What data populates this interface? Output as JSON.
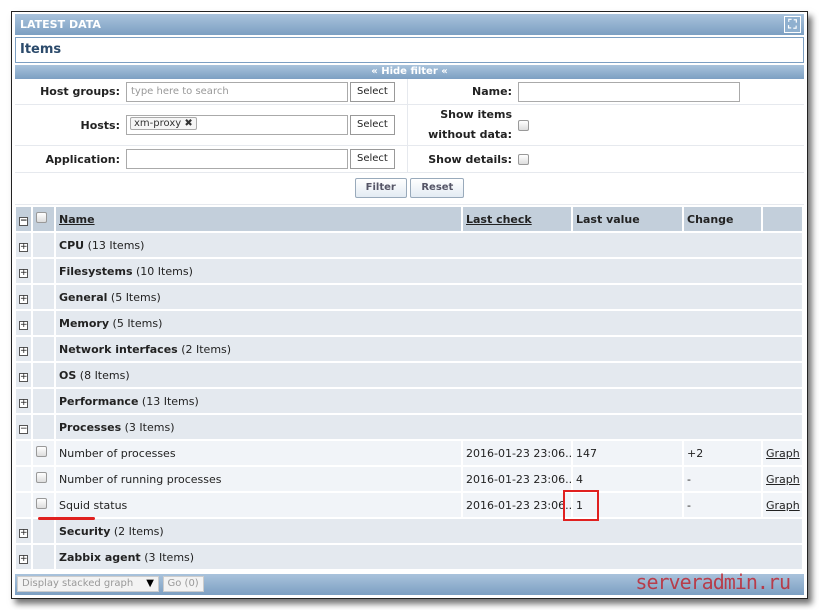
{
  "header": {
    "title": "LATEST DATA",
    "fullscreen_icon": "fullscreen-icon"
  },
  "section_title": "Items",
  "filter_toggle": "Hide filter",
  "filter": {
    "host_groups_label": "Host groups:",
    "host_groups_placeholder": "type here to search",
    "hosts_label": "Hosts:",
    "hosts_chip": "xm-proxy",
    "application_label": "Application:",
    "select_label": "Select",
    "name_label": "Name:",
    "show_items_label_1": "Show items",
    "show_items_label_2": "without data:",
    "show_details_label": "Show details:",
    "filter_button": "Filter",
    "reset_button": "Reset"
  },
  "table": {
    "columns": {
      "name": "Name",
      "last_check": "Last check",
      "last_value": "Last value",
      "change": "Change"
    },
    "groups": [
      {
        "name": "CPU",
        "count": "(13 Items)"
      },
      {
        "name": "Filesystems",
        "count": "(10 Items)"
      },
      {
        "name": "General",
        "count": "(5 Items)"
      },
      {
        "name": "Memory",
        "count": "(5 Items)"
      },
      {
        "name": "Network interfaces",
        "count": "(2 Items)"
      },
      {
        "name": "OS",
        "count": "(8 Items)"
      },
      {
        "name": "Performance",
        "count": "(13 Items)"
      },
      {
        "name": "Processes",
        "count": "(3 Items)"
      },
      {
        "name": "Security",
        "count": "(2 Items)"
      },
      {
        "name": "Zabbix agent",
        "count": "(3 Items)"
      }
    ],
    "items": [
      {
        "name": "Number of processes",
        "last_check": "2016-01-23 23:06...",
        "last_value": "147",
        "change": "+2",
        "link": "Graph"
      },
      {
        "name": "Number of running processes",
        "last_check": "2016-01-23 23:06...",
        "last_value": "4",
        "change": "-",
        "link": "Graph"
      },
      {
        "name": "Squid status",
        "last_check": "2016-01-23 23:06...",
        "last_value": "1",
        "change": "-",
        "link": "Graph"
      }
    ]
  },
  "footer": {
    "action_select": "Display stacked graph",
    "go_button": "Go (0)"
  },
  "watermark": "serveradmin.ru"
}
